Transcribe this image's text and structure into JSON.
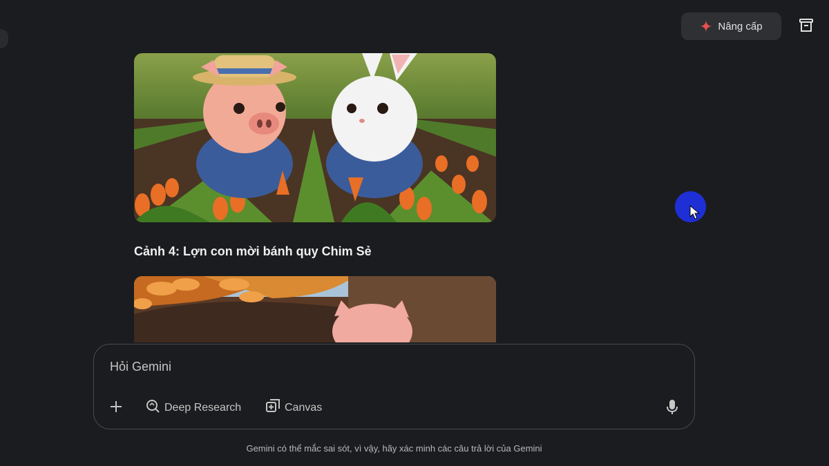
{
  "header": {
    "upgrade_label": "Nâng cấp",
    "upgrade_icon": "sparkle-icon",
    "archive_icon": "archive-icon"
  },
  "chat": {
    "image1_alt_icon": "image-pig-rabbit-carrot-garden",
    "scene_title": "Cảnh 4: Lợn con mời bánh quy Chim Sẻ",
    "image2_alt_icon": "image-pig-tree-autumn"
  },
  "input": {
    "placeholder": "Hỏi Gemini",
    "tools": [
      {
        "icon": "plus-icon",
        "label": ""
      },
      {
        "icon": "deep-research-icon",
        "label": "Deep Research"
      },
      {
        "icon": "canvas-icon",
        "label": "Canvas"
      }
    ],
    "mic_icon": "microphone-icon"
  },
  "footer": {
    "disclaimer": "Gemini có thể mắc sai sót, vì vậy, hãy xác minh các câu trả lời của Gemini"
  },
  "colors": {
    "background": "#1b1c1f",
    "upgrade_bg": "#2f3034",
    "sparkle": "#e8504f",
    "cursor_highlight": "#1f2fd6"
  }
}
